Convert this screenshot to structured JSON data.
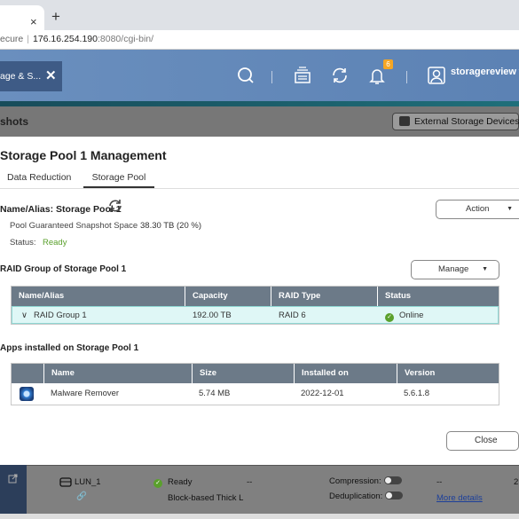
{
  "browser": {
    "tab_close": "×",
    "new_tab": "+",
    "address_secure": "ecure",
    "address_sep": "|",
    "address_host": "176.16.254.190",
    "address_path": ":8080/cgi-bin/"
  },
  "header": {
    "app_tab_label": "age & S...",
    "app_tab_close": "✕",
    "notification_count": "6",
    "username": "storagereview ▾",
    "icons": [
      "search-icon",
      "stack-icon",
      "sync-icon",
      "bell-icon",
      "user-icon"
    ]
  },
  "background": {
    "subheader_title": "shots",
    "external_devices": "External Storage Devices"
  },
  "modal": {
    "title": "Storage Pool 1 Management",
    "tabs": [
      {
        "label": "Data Reduction",
        "active": false
      },
      {
        "label": "Storage Pool",
        "active": true
      }
    ],
    "pool_name": "Name/Alias: Storage Pool 1",
    "snapshot_label": "Pool Guaranteed Snapshot Space",
    "snapshot_value": "38.30 TB (20 %)",
    "status_label": "Status:",
    "status_value": "Ready",
    "action_button": "Action",
    "raid_section_title": "RAID Group of Storage Pool 1",
    "manage_button": "Manage",
    "raid_table": {
      "headers": [
        "Name/Alias",
        "Capacity",
        "RAID Type",
        "Status"
      ],
      "rows": [
        {
          "name": "RAID Group 1",
          "capacity": "192.00 TB",
          "raid_type": "RAID 6",
          "status": "Online"
        }
      ]
    },
    "apps_section_title": "Apps installed on Storage Pool 1",
    "apps_table": {
      "headers": [
        "Name",
        "Size",
        "Installed on",
        "Version"
      ],
      "rows": [
        {
          "name": "Malware Remover",
          "size": "5.74 MB",
          "installed_on": "2022-12-01",
          "version": "5.6.1.8"
        }
      ]
    },
    "close_button": "Close"
  },
  "bottom": {
    "lun_name": "LUN_1",
    "status": "Ready",
    "dash1": "--",
    "type": "Block-based Thick L",
    "compression_label": "Compression:",
    "dedup_label": "Deduplication:",
    "dash2": "--",
    "more_details": "More details",
    "edge_digit": "2"
  },
  "colors": {
    "accent_ready": "#5aa02c",
    "header_blue": "#5c82b4",
    "table_header": "#6c7a88",
    "raid_row_bg": "#dff7f6"
  }
}
